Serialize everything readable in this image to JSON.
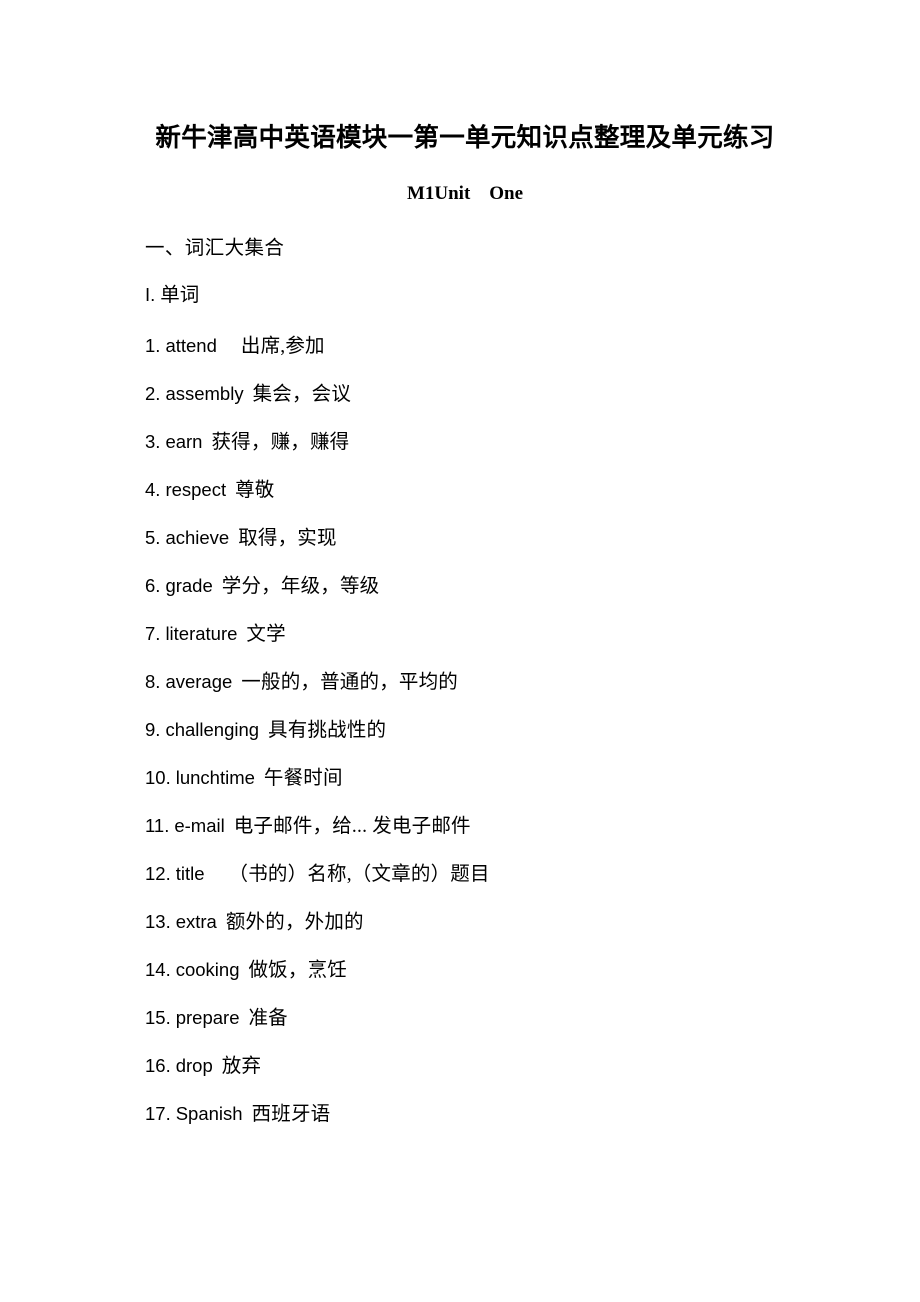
{
  "document": {
    "title": "新牛津高中英语模块一第一单元知识点整理及单元练习",
    "subtitle": "M1Unit One",
    "background_color": "#ffffff",
    "text_color": "#000000"
  },
  "sections": {
    "vocabulary_heading": "一、词汇大集合",
    "words_heading_marker": "I.",
    "words_heading_label": "单词"
  },
  "vocabulary": [
    {
      "num": "1.",
      "word": "attend",
      "gloss": "出席,参加",
      "wide_gap": true
    },
    {
      "num": "2.",
      "word": "assembly",
      "gloss": "集会，会议",
      "wide_gap": false
    },
    {
      "num": "3.",
      "word": "earn",
      "gloss": "获得，赚，赚得",
      "wide_gap": false
    },
    {
      "num": "4.",
      "word": "respect",
      "gloss": "尊敬",
      "wide_gap": false
    },
    {
      "num": "5.",
      "word": "achieve",
      "gloss": "取得，实现",
      "wide_gap": false
    },
    {
      "num": "6.",
      "word": "grade",
      "gloss": "学分，年级，等级",
      "wide_gap": false
    },
    {
      "num": "7.",
      "word": "literature",
      "gloss": "文学",
      "wide_gap": false
    },
    {
      "num": "8.",
      "word": "average",
      "gloss": "一般的，普通的，平均的",
      "wide_gap": false
    },
    {
      "num": "9.",
      "word": "challenging",
      "gloss": "具有挑战性的",
      "wide_gap": false
    },
    {
      "num": "10.",
      "word": "lunchtime",
      "gloss": "午餐时间",
      "wide_gap": false
    },
    {
      "num": "11.",
      "word": "e-mail",
      "gloss": "电子邮件，给... 发电子邮件",
      "wide_gap": false
    },
    {
      "num": "12.",
      "word": "title",
      "gloss": "（书的）名称,（文章的）题目",
      "wide_gap": true
    },
    {
      "num": "13.",
      "word": "extra",
      "gloss": "额外的，外加的",
      "wide_gap": false
    },
    {
      "num": "14.",
      "word": "cooking",
      "gloss": "做饭，烹饪",
      "wide_gap": false
    },
    {
      "num": "15.",
      "word": "prepare",
      "gloss": "准备",
      "wide_gap": false
    },
    {
      "num": "16.",
      "word": "drop",
      "gloss": "放弃",
      "wide_gap": false
    },
    {
      "num": "17.",
      "word": "Spanish",
      "gloss": "西班牙语",
      "wide_gap": false
    }
  ]
}
